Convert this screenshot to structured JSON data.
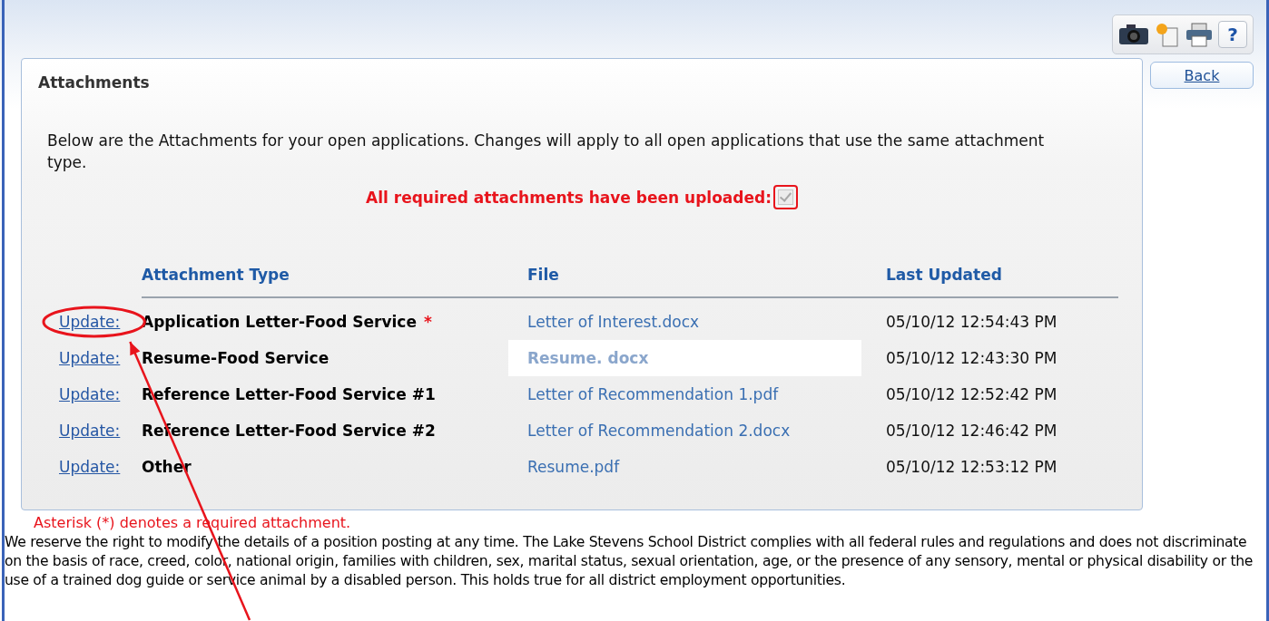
{
  "toolbar": {
    "help": "?"
  },
  "back_button": {
    "label": "Back"
  },
  "panel": {
    "title": "Attachments",
    "intro": "Below are the Attachments for your open applications. Changes will apply to all open applications that use the same attachment type.",
    "status": {
      "label": "All required attachments have been uploaded:",
      "checked": true,
      "disabled": true,
      "highlighted": true
    },
    "columns": [
      "Attachment Type",
      "File",
      "Last Updated"
    ],
    "rows": [
      {
        "action": "Update:",
        "type": "Application Letter-Food Service",
        "required_mark": "*",
        "file": "Letter of Interest.docx",
        "kind": "link",
        "updated": "05/10/12 12:54:43 PM",
        "circled": true
      },
      {
        "action": "Update:",
        "type": "Resume-Food Service",
        "file": "Resume. docx",
        "kind": "boxed",
        "updated": "05/10/12 12:43:30 PM",
        "circled": false
      },
      {
        "action": "Update:",
        "type": "Reference Letter-Food Service #1",
        "file": "Letter of Recommendation 1.pdf",
        "kind": "link",
        "updated": "05/10/12 12:52:42 PM",
        "circled": false
      },
      {
        "action": "Update:",
        "type": "Reference Letter-Food Service #2",
        "file": "Letter of Recommendation 2.docx",
        "kind": "link",
        "updated": "05/10/12 12:46:42 PM",
        "circled": false
      },
      {
        "action": "Update:",
        "type": "Other",
        "file": "Resume.pdf",
        "kind": "link",
        "updated": "05/10/12 12:53:12 PM",
        "circled": false
      }
    ]
  },
  "legend": "Asterisk (*) denotes a required attachment.",
  "disclaimer": "We reserve the right to modify the details of a position posting at any time. The Lake Stevens School District complies with all federal rules and regulations and does not discriminate on the basis of race, creed, color, national origin, families with children, sex, marital status, sexual orientation, age, or the presence of any sensory, mental or physical disability or the use of a trained dog guide or service animal by a disabled person. This holds true for all district employment opportunities.",
  "annotation_arrow": true
}
